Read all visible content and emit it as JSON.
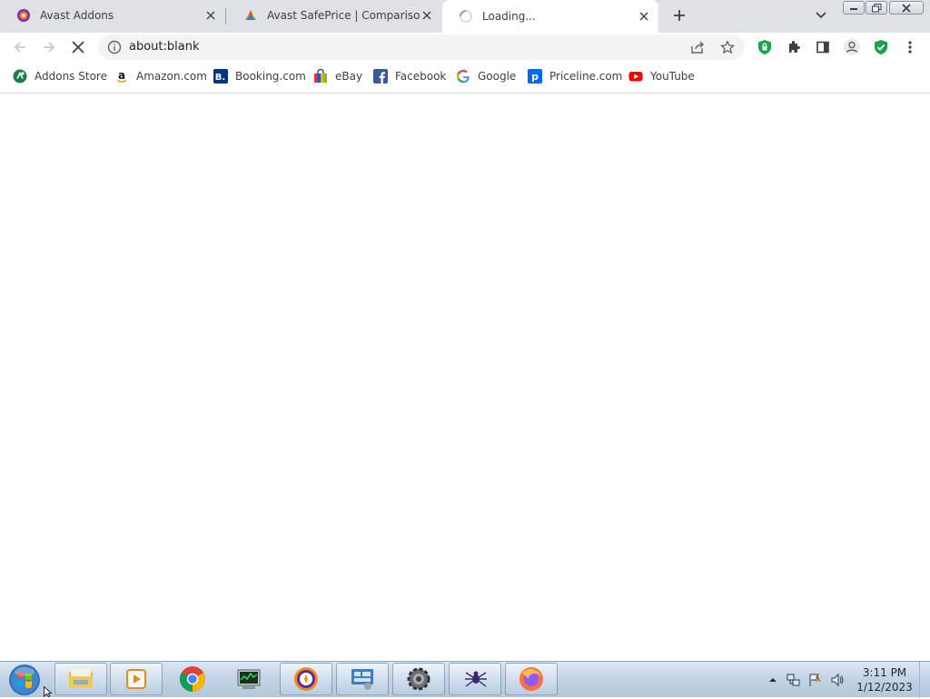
{
  "window": {
    "tabs": [
      {
        "title": "Avast Addons",
        "icon": "avast-addons-icon",
        "active": false
      },
      {
        "title": "Avast SafePrice | Comparison, de",
        "icon": "safeprice-icon",
        "active": false
      },
      {
        "title": "Loading...",
        "icon": "loading-spinner-icon",
        "active": true
      }
    ]
  },
  "toolbar": {
    "url": "about:blank"
  },
  "bookmarks": [
    {
      "label": "Addons Store",
      "icon": "addons-store-icon"
    },
    {
      "label": "Amazon.com",
      "icon": "amazon-icon"
    },
    {
      "label": "Booking.com",
      "icon": "booking-icon"
    },
    {
      "label": "eBay",
      "icon": "ebay-icon"
    },
    {
      "label": "Facebook",
      "icon": "facebook-icon"
    },
    {
      "label": "Google",
      "icon": "google-icon"
    },
    {
      "label": "Priceline.com",
      "icon": "priceline-icon"
    },
    {
      "label": "YouTube",
      "icon": "youtube-icon"
    }
  ],
  "taskbar": {
    "apps": [
      "file-explorer-icon",
      "media-player-icon",
      "chrome-icon",
      "task-manager-icon",
      "avast-browser-icon",
      "control-panel-icon",
      "settings-gear-icon",
      "spider-app-icon",
      "firefox-icon"
    ],
    "clock": {
      "time": "3:11 PM",
      "date": "1/12/2023"
    }
  },
  "colors": {
    "tabstrip": "#dee1e6",
    "omnibox": "#f1f3f4",
    "avast_shield": "#1aa34a",
    "taskbar": "#c4d4e6"
  }
}
